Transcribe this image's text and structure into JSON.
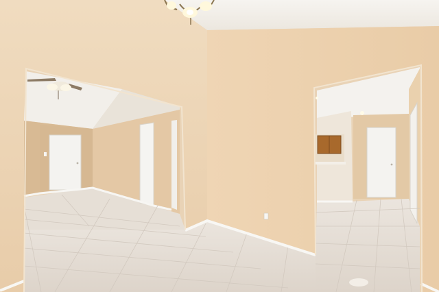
{
  "scene": {
    "description_visible_text": [],
    "colors": {
      "wall_front": "#efd6b8",
      "wall_shadow": "#e2c6a4",
      "wall_back": "#dcbf9c",
      "ceiling": "#f4f1ec",
      "floor": "#e2dbd3",
      "floor_grout": "#cfc6bd",
      "trim": "#f7f6f3",
      "door": "#f3f2ef",
      "cabinet": "#a8692c"
    }
  }
}
